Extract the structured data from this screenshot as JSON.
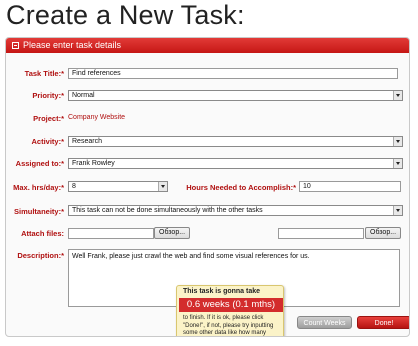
{
  "page": {
    "title": "Create a New Task:"
  },
  "panel": {
    "header": "Please enter task details"
  },
  "form": {
    "task_title_label": "Task Title:*",
    "task_title_value": "Find references",
    "priority_label": "Priority:*",
    "priority_value": "Normal",
    "project_label": "Project:*",
    "project_value": "Company Website",
    "activity_label": "Activity:*",
    "activity_value": "Research",
    "assigned_label": "Assigned to:*",
    "assigned_value": "Frank Rowley",
    "max_hrs_label": "Max. hrs/day:*",
    "max_hrs_value": "8",
    "hours_needed_label": "Hours Needed to Accomplish:*",
    "hours_needed_value": "10",
    "simultaneity_label": "Simultaneity:*",
    "simultaneity_value": "This task can not be done simultaneously with the other tasks",
    "attach_label": "Attach files:",
    "browse_label": "Обзор...",
    "description_label": "Description:*",
    "description_value": "Well Frank, please just crawl the web and find some visual references for us."
  },
  "tooltip": {
    "title": "This task is gonna take",
    "highlight": "0.6 weeks (0.1 mths)",
    "text": "to finish. If it is ok, please click \"Done!\", if not, please try inputting some other data like how many hours to spend on it etc."
  },
  "buttons": {
    "count_weeks": "Count Weeks",
    "done": "Done!"
  }
}
